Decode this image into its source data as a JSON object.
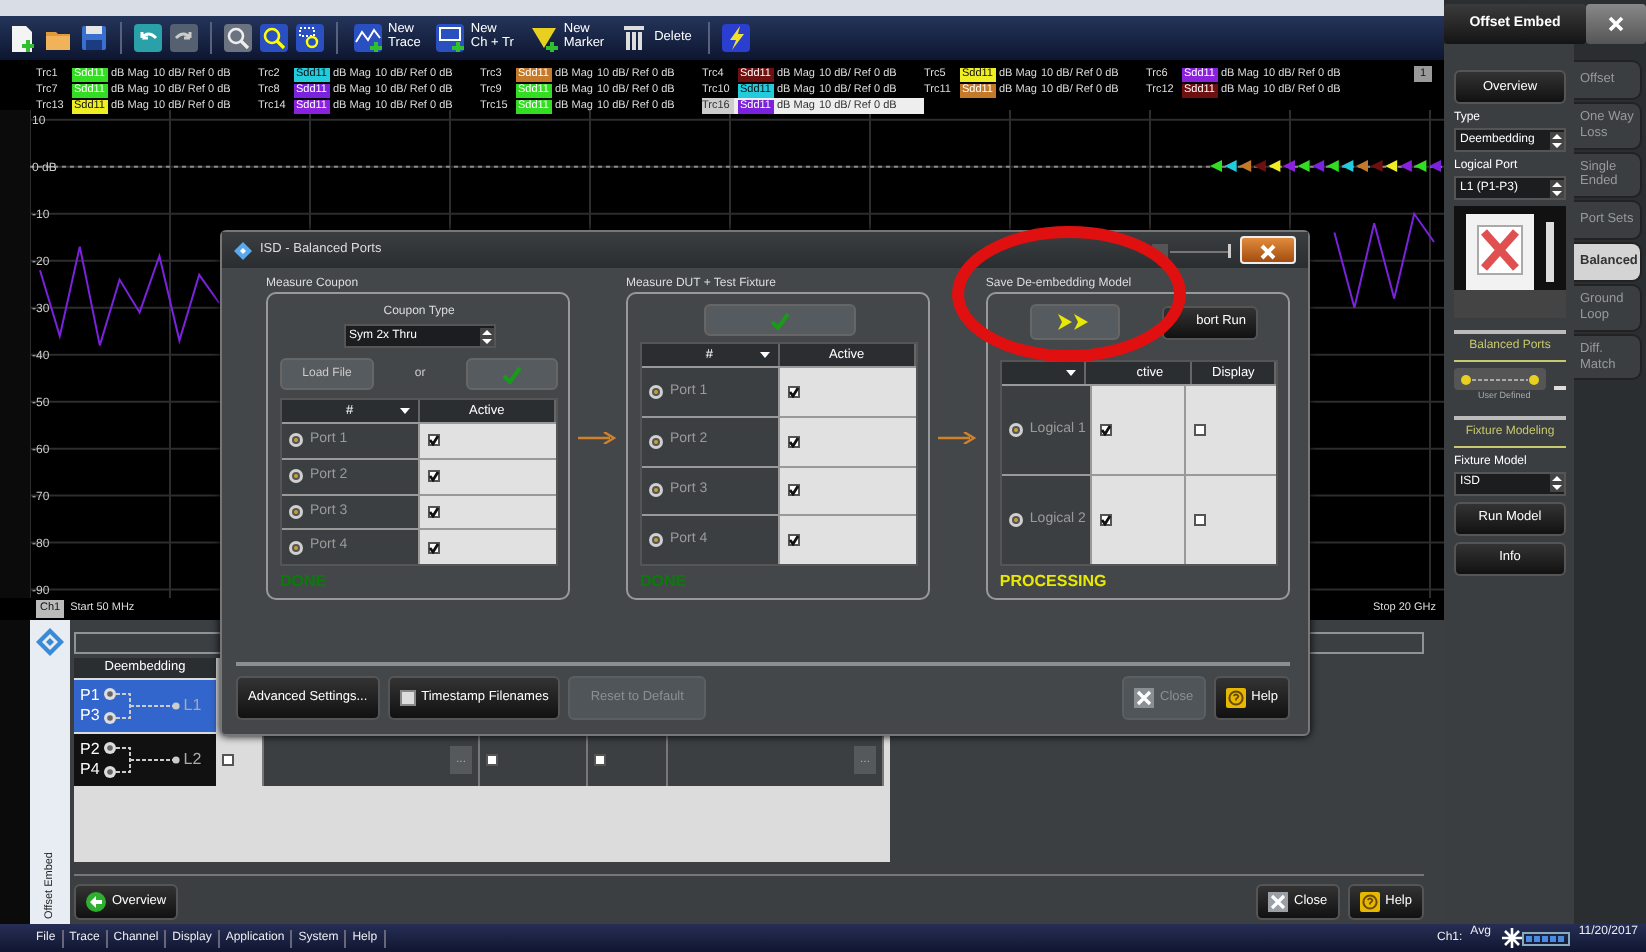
{
  "toolbar": {
    "buttons": [
      "New\nTrace",
      "New\nCh + Tr",
      "New\nMarker",
      "Delete"
    ]
  },
  "traces": [
    {
      "name": "Trc1",
      "parameter": "Sdd11",
      "format": "dB Mag",
      "scale": "10 dB/ Ref 0 dB",
      "color": "#33dd22",
      "selected": false
    },
    {
      "name": "Trc2",
      "parameter": "Sdd11",
      "format": "dB Mag",
      "scale": "10 dB/ Ref 0 dB",
      "color": "#22ccdd",
      "selected": false
    },
    {
      "name": "Trc3",
      "parameter": "Sdd11",
      "format": "dB Mag",
      "scale": "10 dB/ Ref 0 dB",
      "color": "#c47a2a",
      "selected": false
    },
    {
      "name": "Trc4",
      "parameter": "Sdd11",
      "format": "dB Mag",
      "scale": "10 dB/ Ref 0 dB",
      "color": "#6e1010",
      "selected": false
    },
    {
      "name": "Trc5",
      "parameter": "Sdd11",
      "format": "dB Mag",
      "scale": "10 dB/ Ref 0 dB",
      "color": "#eeee22",
      "selected": false
    },
    {
      "name": "Trc6",
      "parameter": "Sdd11",
      "format": "dB Mag",
      "scale": "10 dB/ Ref 0 dB",
      "color": "#8a22dd",
      "selected": false
    },
    {
      "name": "Trc7",
      "parameter": "Sdd11",
      "format": "dB Mag",
      "scale": "10 dB/ Ref 0 dB",
      "color": "#33dd22",
      "selected": false
    },
    {
      "name": "Trc8",
      "parameter": "Sdd11",
      "format": "dB Mag",
      "scale": "10 dB/ Ref 0 dB",
      "color": "#7a22dd",
      "selected": false
    },
    {
      "name": "Trc9",
      "parameter": "Sdd11",
      "format": "dB Mag",
      "scale": "10 dB/ Ref 0 dB",
      "color": "#33dd22",
      "selected": false
    },
    {
      "name": "Trc10",
      "parameter": "Sdd11",
      "format": "dB Mag",
      "scale": "10 dB/ Ref 0 dB",
      "color": "#22ccdd",
      "selected": false
    },
    {
      "name": "Trc11",
      "parameter": "Sdd11",
      "format": "dB Mag",
      "scale": "10 dB/ Ref 0 dB",
      "color": "#c47a2a",
      "selected": false
    },
    {
      "name": "Trc12",
      "parameter": "Sdd11",
      "format": "dB Mag",
      "scale": "10 dB/ Ref 0 dB",
      "color": "#6e1010",
      "selected": false
    },
    {
      "name": "Trc13",
      "parameter": "Sdd11",
      "format": "dB Mag",
      "scale": "10 dB/ Ref 0 dB",
      "color": "#eeee22",
      "selected": false
    },
    {
      "name": "Trc14",
      "parameter": "Sdd11",
      "format": "dB Mag",
      "scale": "10 dB/ Ref 0 dB",
      "color": "#8a22dd",
      "selected": false
    },
    {
      "name": "Trc15",
      "parameter": "Sdd11",
      "format": "dB Mag",
      "scale": "10 dB/ Ref 0 dB",
      "color": "#33dd22",
      "selected": false
    },
    {
      "name": "Trc16",
      "parameter": "Sdd11",
      "format": "dB Mag",
      "scale": "10 dB/ Ref 0 dB",
      "color": "#7a22dd",
      "selected": true
    }
  ],
  "legend_page": "1",
  "chart": {
    "channel": "Ch1",
    "start": "Start  50 MHz",
    "stop": "Stop  20 GHz",
    "chart_data": {
      "type": "line",
      "ylim": [
        -91.8,
        12.1
      ],
      "grid": true,
      "ref_lines": [
        {
          "axis": "y",
          "value": 0
        }
      ],
      "yticks": [
        {
          "value": 10,
          "label": "10"
        },
        {
          "value": 0,
          "label": "0 dB"
        },
        {
          "value": -10,
          "label": "-10"
        },
        {
          "value": -20,
          "label": "-20"
        },
        {
          "value": -30,
          "label": "-30"
        },
        {
          "value": -40,
          "label": "-40"
        },
        {
          "value": -50,
          "label": "-50"
        },
        {
          "value": -60,
          "label": "-60"
        },
        {
          "value": -70,
          "label": "-70"
        },
        {
          "value": -80,
          "label": "-80"
        },
        {
          "value": -90,
          "label": "-90"
        }
      ],
      "series": [
        {
          "color": "#7a22dd",
          "values": [
            -22,
            -36,
            -17,
            -38,
            -24,
            -31,
            -19,
            -37,
            -23,
            -29,
            null,
            null,
            null,
            null,
            null,
            null,
            null,
            null,
            null,
            null,
            null,
            null,
            null,
            null,
            null,
            null,
            null,
            null,
            null,
            null,
            null,
            null,
            null,
            null,
            null,
            null,
            null,
            null,
            null,
            null,
            null,
            null,
            null,
            null,
            null,
            null,
            null,
            null,
            null,
            null,
            null,
            null,
            null,
            null,
            null,
            null,
            null,
            null,
            null,
            null,
            null,
            null,
            null,
            null,
            null,
            -14,
            -30,
            -12,
            -28,
            -10,
            -16
          ]
        }
      ]
    }
  },
  "dialog": {
    "title": "ISD - Balanced Ports",
    "groups": [
      {
        "kind": "coupon",
        "title": "Measure Coupon",
        "coupon_type_label": "Coupon Type",
        "coupon_type": "Sym 2x Thru",
        "load_file": "Load File",
        "or": "or",
        "headers": [
          {
            "label": "#",
            "caret": true
          },
          {
            "label": "Active"
          }
        ],
        "rows": [
          {
            "label": "Port 1",
            "active": true
          },
          {
            "label": "Port 2",
            "active": true
          },
          {
            "label": "Port 3",
            "active": true
          },
          {
            "label": "Port 4",
            "active": true
          }
        ],
        "status": {
          "text": "DONE",
          "color": "#0b7a0b"
        }
      },
      {
        "kind": "dut",
        "title": "Measure DUT + Test Fixture",
        "headers": [
          {
            "label": "#",
            "caret": true
          },
          {
            "label": "Active"
          }
        ],
        "rows": [
          {
            "label": "Port 1",
            "active": true
          },
          {
            "label": "Port 2",
            "active": true
          },
          {
            "label": "Port 3",
            "active": true
          },
          {
            "label": "Port 4",
            "active": true
          }
        ],
        "status": {
          "text": "DONE",
          "color": "#0b7a0b"
        }
      },
      {
        "kind": "model",
        "title": "Save De-embedding Model",
        "abort": "bort Run",
        "circled": true,
        "headers": [
          {
            "caret": true
          },
          {
            "label": "ctive"
          },
          {
            "label": "Display"
          }
        ],
        "rows": [
          {
            "label": "Logical 1",
            "active": true,
            "display": false
          },
          {
            "label": "Logical 2",
            "active": true,
            "display": false
          }
        ],
        "status": {
          "text": "PROCESSING",
          "color": "#e8e800"
        }
      }
    ],
    "advanced": "Advanced Settings...",
    "timestamp": {
      "label": "Timestamp Filenames",
      "checked": false
    },
    "reset": {
      "label": "Reset to Default",
      "disabled": true
    },
    "close": {
      "label": "Close",
      "disabled": true
    },
    "help": "Help"
  },
  "bottom_panel": {
    "side_label": "Offset Embed",
    "header": "Deembedding",
    "rows": [
      {
        "ports": [
          "P1",
          "P3"
        ],
        "label": "L1",
        "selected": true
      },
      {
        "ports": [
          "P2",
          "P4"
        ],
        "label": "L2",
        "selected": false,
        "cells": [
          {
            "kind": "check",
            "checked": false
          },
          {
            "kind": "more",
            "label": "..."
          },
          {
            "kind": "check",
            "checked": false
          },
          {
            "kind": "check",
            "checked": false
          },
          {
            "kind": "more",
            "label": "..."
          }
        ]
      }
    ],
    "overview": "Overview",
    "close": "Close",
    "help": "Help"
  },
  "right_panel": {
    "title": "Offset Embed",
    "overview": "Overview",
    "type_label": "Type",
    "type": "Deembedding",
    "logical_port_label": "Logical Port",
    "logical_port": "L1 (P1-P3)",
    "section_ports": "Balanced Ports",
    "user_defined": "User Defined",
    "section_fixture": "Fixture Modeling",
    "fixture_model_label": "Fixture Model",
    "fixture_model": "ISD",
    "run_model": "Run Model",
    "info": "Info",
    "tabs": [
      {
        "label": "Offset",
        "selected": false
      },
      {
        "label": "One Way Loss",
        "selected": false
      },
      {
        "label": "Single Ended",
        "selected": false
      },
      {
        "label": "Port Sets",
        "selected": false
      },
      {
        "label": "Balanced",
        "selected": true
      },
      {
        "label": "Ground Loop",
        "selected": false
      },
      {
        "label": "Diff. Match",
        "selected": false
      }
    ]
  },
  "status_bar": {
    "menus": [
      "File",
      "Trace",
      "Channel",
      "Display",
      "Application",
      "System",
      "Help"
    ],
    "channel": "Ch1:",
    "avg": "Avg",
    "date": "11/20/2017"
  }
}
